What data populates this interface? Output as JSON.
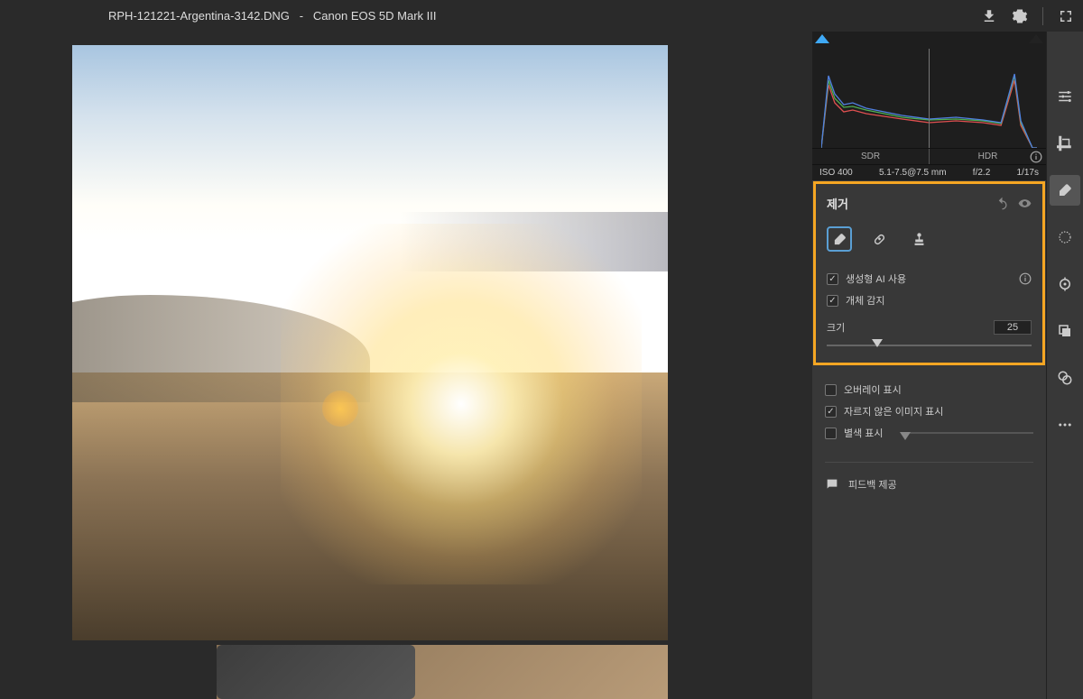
{
  "header": {
    "filename": "RPH-121221-Argentina-3142.DNG",
    "separator": "-",
    "camera": "Canon EOS 5D Mark III"
  },
  "histogram": {
    "sdr_label": "SDR",
    "hdr_label": "HDR"
  },
  "exif": {
    "iso": "ISO 400",
    "focal": "5.1-7.5@7.5 mm",
    "aperture": "f/2.2",
    "shutter": "1/17s"
  },
  "panel": {
    "title": "제거",
    "tools": {
      "eraser": "eraser",
      "bandage": "heal",
      "stamp": "clone"
    },
    "checkbox_gen_ai": "생성형 AI 사용",
    "checkbox_detect": "개체 감지",
    "size_label": "크기",
    "size_value": "25"
  },
  "lower": {
    "overlay_label": "오버레이 표시",
    "uncropped_label": "자르지 않은 이미지 표시",
    "visualize_label": "별색 표시"
  },
  "feedback": {
    "label": "피드백 제공"
  }
}
